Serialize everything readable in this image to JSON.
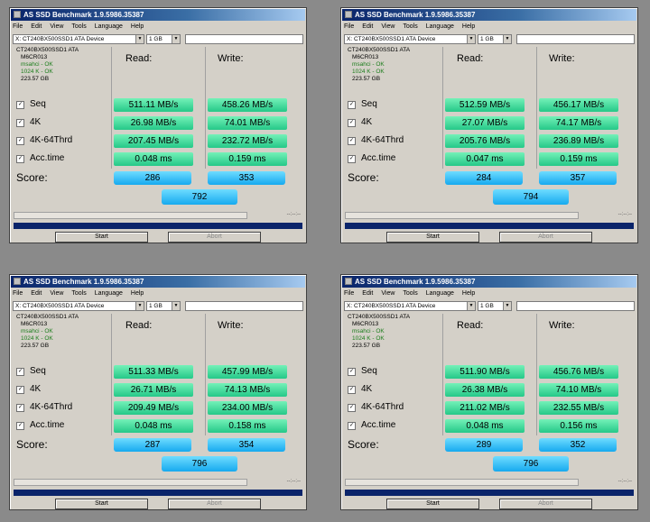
{
  "app": {
    "title": "AS SSD Benchmark 1.9.5986.35387",
    "menu": [
      "File",
      "Edit",
      "View",
      "Tools",
      "Language",
      "Help"
    ],
    "device": "X: CT240BX500SSD1 ATA Device",
    "size": "1 GB",
    "info": {
      "model": "CT240BX500SSD1 ATA",
      "firmware": "M6CR013",
      "driver": "msahci - OK",
      "align": "1024 K - OK",
      "capacity": "223.57 GB"
    },
    "read_header": "Read:",
    "write_header": "Write:",
    "tests": [
      "Seq",
      "4K",
      "4K-64Thrd",
      "Acc.time"
    ],
    "check_mark": "✓",
    "score_label": "Score:",
    "time_text": "--:--:--",
    "start_label": "Start",
    "abort_label": "Abort",
    "dropdown_arrow": "▼",
    "colors": {
      "value_box": "#35d89a",
      "score_box": "#25b6f5",
      "progress": "#0a246a"
    }
  },
  "runs": [
    {
      "read": [
        "511.11 MB/s",
        "26.98 MB/s",
        "207.45 MB/s",
        "0.048 ms"
      ],
      "write": [
        "458.26 MB/s",
        "74.01 MB/s",
        "232.72 MB/s",
        "0.159 ms"
      ],
      "score_read": "286",
      "score_write": "353",
      "score_total": "792"
    },
    {
      "read": [
        "512.59 MB/s",
        "27.07 MB/s",
        "205.76 MB/s",
        "0.047 ms"
      ],
      "write": [
        "456.17 MB/s",
        "74.17 MB/s",
        "236.89 MB/s",
        "0.159 ms"
      ],
      "score_read": "284",
      "score_write": "357",
      "score_total": "794"
    },
    {
      "read": [
        "511.33 MB/s",
        "26.71 MB/s",
        "209.49 MB/s",
        "0.048 ms"
      ],
      "write": [
        "457.99 MB/s",
        "74.13 MB/s",
        "234.00 MB/s",
        "0.158 ms"
      ],
      "score_read": "287",
      "score_write": "354",
      "score_total": "796"
    },
    {
      "read": [
        "511.90 MB/s",
        "26.38 MB/s",
        "211.02 MB/s",
        "0.048 ms"
      ],
      "write": [
        "456.76 MB/s",
        "74.10 MB/s",
        "232.55 MB/s",
        "0.156 ms"
      ],
      "score_read": "289",
      "score_write": "352",
      "score_total": "796"
    }
  ]
}
